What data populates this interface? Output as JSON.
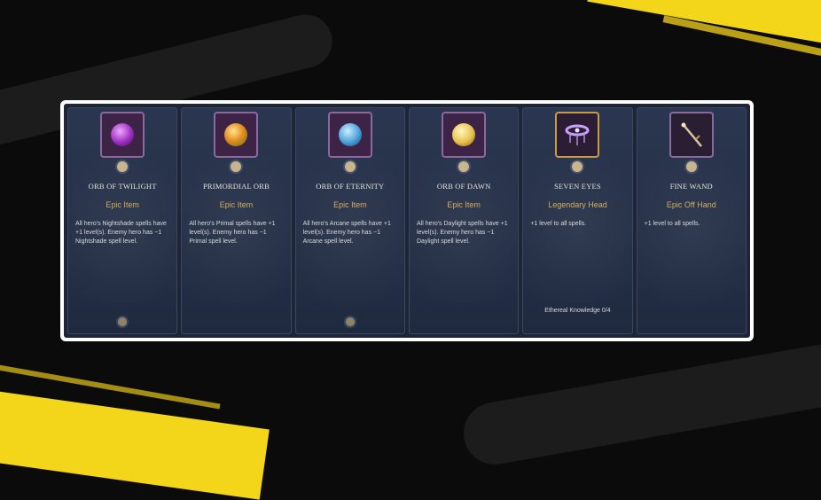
{
  "colors": {
    "accent_yellow": "#f3d51a",
    "epic": "#d4aa58",
    "panel_bg": "#1d2536"
  },
  "cards": [
    {
      "name": "ORB OF TWILIGHT",
      "rarity": "Epic Item",
      "description": "All hero's Nightshade spells have +1 level(s). Enemy hero has −1 Nightshade spell level.",
      "footer": "",
      "icon": "purple-orb-icon"
    },
    {
      "name": "PRIMORDIAL ORB",
      "rarity": "Epic Item",
      "description": "All hero's Primal spells have +1 level(s). Enemy hero has −1 Primal spell level.",
      "footer": "",
      "icon": "green-orb-icon"
    },
    {
      "name": "ORB OF ETERNITY",
      "rarity": "Epic Item",
      "description": "All hero's Arcane spells have +1 level(s). Enemy hero has −1 Arcane spell level.",
      "footer": "",
      "icon": "blue-orb-icon"
    },
    {
      "name": "ORB OF DAWN",
      "rarity": "Epic Item",
      "description": "All hero's Daylight spells have +1 level(s). Enemy hero has −1 Daylight spell level.",
      "footer": "",
      "icon": "gold-orb-icon"
    },
    {
      "name": "SEVEN EYES",
      "rarity": "Legendary Head",
      "description": "+1 level to all spells.",
      "footer": "Ethereal Knowledge 0/4",
      "icon": "circlet-icon"
    },
    {
      "name": "FINE WAND",
      "rarity": "Epic Off Hand",
      "description": "+1 level to all spells.",
      "footer": "",
      "icon": "wand-icon"
    }
  ]
}
